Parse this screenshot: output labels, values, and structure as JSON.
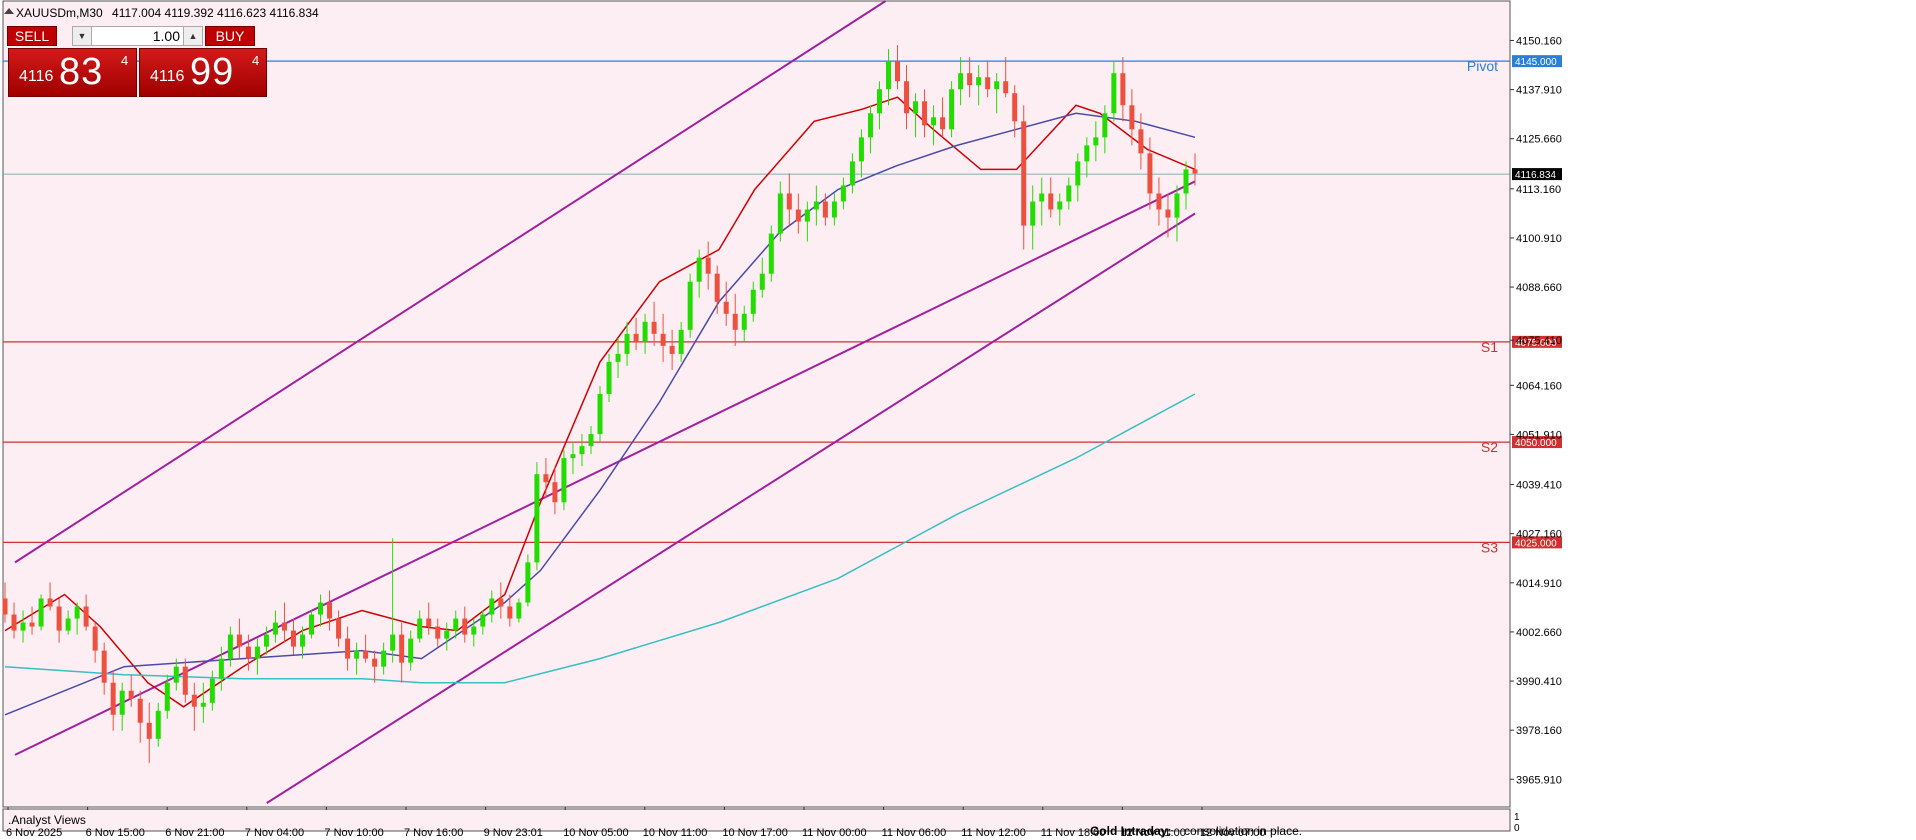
{
  "header": {
    "symbol_label": "XAUUSDm,M30",
    "ohlc": "4117.004 4119.392 4116.623 4116.834"
  },
  "trade_panel": {
    "sell_label": "SELL",
    "buy_label": "BUY",
    "lot_value": "1.00",
    "sell_price_small": "4116",
    "sell_price_big": "83",
    "sell_price_sup": "4",
    "buy_price_small": "4116",
    "buy_price_big": "99",
    "buy_price_sup": "4",
    "down_arrow": "▼",
    "up_arrow": "▲"
  },
  "indicator_panel": {
    "label": ".Analyst Views",
    "text_title": "Gold Intraday:",
    "text_body": "consolidation in place.",
    "scale_top": "1",
    "scale_bottom": "0"
  },
  "colors": {
    "background": "#fdeef4",
    "bull": "#22dd00",
    "bear": "#ee5040",
    "ma_red": "#d00000",
    "ma_blue": "#4a4aa8",
    "ma_cyan": "#36c0c0",
    "channel": "#a020a0",
    "pivot": "#2a7fd8",
    "support": "#d03030"
  },
  "chart_data": {
    "type": "candlestick",
    "symbol": "XAUUSDm",
    "timeframe": "M30",
    "ylim": [
      3959,
      4160
    ],
    "y_ticks": [
      "4150.160",
      "4137.910",
      "4125.660",
      "4113.160",
      "4100.910",
      "4088.660",
      "4075.410",
      "4064.160",
      "4051.910",
      "4039.410",
      "4027.160",
      "4014.910",
      "4002.660",
      "3990.410",
      "3978.160",
      "3965.910"
    ],
    "x_ticks": [
      "6 Nov 2025",
      "6 Nov 15:00",
      "6 Nov 21:00",
      "7 Nov 04:00",
      "7 Nov 10:00",
      "7 Nov 16:00",
      "9 Nov 23:01",
      "10 Nov 05:00",
      "10 Nov 11:00",
      "10 Nov 17:00",
      "11 Nov 00:00",
      "11 Nov 06:00",
      "11 Nov 12:00",
      "11 Nov 18:00",
      "12 Nov 01:00",
      "12 Nov 07:00"
    ],
    "current_price": "4116.834",
    "levels": [
      {
        "name": "Pivot",
        "value": 4145,
        "label": "4145.000"
      },
      {
        "name": "S1",
        "value": 4075,
        "label": "4075.000"
      },
      {
        "name": "S2",
        "value": 4050,
        "label": "4050.000"
      },
      {
        "name": "S3",
        "value": 4025,
        "label": "4025.000"
      }
    ],
    "channels": [
      {
        "x": [
          0,
          0.74
        ],
        "y": [
          4020,
          4160
        ]
      },
      {
        "x": [
          0,
          1
        ],
        "y": [
          3972,
          4115
        ]
      },
      {
        "x": [
          0.22,
          1
        ],
        "y": [
          3960,
          4107
        ]
      }
    ],
    "moving_averages": [
      {
        "color": "ma_red",
        "x": [
          0,
          0.05,
          0.08,
          0.12,
          0.15,
          0.2,
          0.25,
          0.3,
          0.35,
          0.38,
          0.42,
          0.45,
          0.5,
          0.55,
          0.6,
          0.63,
          0.68,
          0.72,
          0.75,
          0.78,
          0.82,
          0.85,
          0.9,
          0.92,
          0.96,
          1
        ],
        "y": [
          4003,
          4012,
          4004,
          3990,
          3984,
          3994,
          4003,
          4008,
          4004,
          4003,
          4012,
          4035,
          4070,
          4090,
          4098,
          4113,
          4130,
          4133,
          4136,
          4128,
          4118,
          4118,
          4134,
          4132,
          4123,
          4118
        ]
      },
      {
        "color": "ma_blue",
        "x": [
          0,
          0.1,
          0.2,
          0.3,
          0.35,
          0.38,
          0.42,
          0.45,
          0.5,
          0.55,
          0.6,
          0.65,
          0.7,
          0.75,
          0.8,
          0.85,
          0.9,
          0.95,
          1
        ],
        "y": [
          3982,
          3994,
          3996,
          3998,
          3996,
          4002,
          4010,
          4018,
          4038,
          4060,
          4085,
          4102,
          4113,
          4119,
          4124,
          4128,
          4132,
          4130,
          4126
        ]
      },
      {
        "color": "ma_cyan",
        "x": [
          0,
          0.1,
          0.2,
          0.3,
          0.35,
          0.42,
          0.5,
          0.6,
          0.7,
          0.8,
          0.9,
          1
        ],
        "y": [
          3994,
          3992,
          3991,
          3991,
          3990,
          3990,
          3996,
          4005,
          4016,
          4032,
          4046,
          4062
        ]
      }
    ],
    "candles": [
      [
        4011,
        4015,
        4005,
        4007
      ],
      [
        4007,
        4010,
        4001,
        4003
      ],
      [
        4003,
        4008,
        4000,
        4005
      ],
      [
        4005,
        4009,
        4002,
        4004
      ],
      [
        4004,
        4012,
        4003,
        4011
      ],
      [
        4011,
        4015,
        4008,
        4009
      ],
      [
        4009,
        4011,
        4000,
        4003
      ],
      [
        4003,
        4008,
        4002,
        4006
      ],
      [
        4006,
        4010,
        4002,
        4009
      ],
      [
        4009,
        4012,
        4003,
        4004
      ],
      [
        4004,
        4005,
        3995,
        3998
      ],
      [
        3998,
        4000,
        3987,
        3990
      ],
      [
        3990,
        3993,
        3978,
        3982
      ],
      [
        3982,
        3990,
        3978,
        3988
      ],
      [
        3988,
        3992,
        3984,
        3986
      ],
      [
        3986,
        3988,
        3975,
        3980
      ],
      [
        3980,
        3985,
        3970,
        3976
      ],
      [
        3976,
        3985,
        3974,
        3983
      ],
      [
        3983,
        3992,
        3981,
        3990
      ],
      [
        3990,
        3996,
        3988,
        3994
      ],
      [
        3994,
        3996,
        3985,
        3987
      ],
      [
        3987,
        3990,
        3978,
        3984
      ],
      [
        3984,
        3990,
        3980,
        3985
      ],
      [
        3985,
        3993,
        3983,
        3991
      ],
      [
        3991,
        3999,
        3988,
        3996
      ],
      [
        3996,
        4004,
        3994,
        4002
      ],
      [
        4002,
        4006,
        3996,
        3999
      ],
      [
        3999,
        4002,
        3993,
        3996
      ],
      [
        3996,
        4001,
        3992,
        3999
      ],
      [
        3999,
        4004,
        3997,
        4002
      ],
      [
        4002,
        4008,
        4000,
        4005
      ],
      [
        4005,
        4010,
        4000,
        4003
      ],
      [
        4003,
        4006,
        3997,
        3999
      ],
      [
        3999,
        4004,
        3996,
        4002
      ],
      [
        4002,
        4008,
        4001,
        4007
      ],
      [
        4007,
        4012,
        4004,
        4010
      ],
      [
        4010,
        4013,
        4003,
        4006
      ],
      [
        4006,
        4008,
        3999,
        4001
      ],
      [
        4001,
        4004,
        3993,
        3996
      ],
      [
        3996,
        4000,
        3992,
        3998
      ],
      [
        3998,
        4002,
        3995,
        3996
      ],
      [
        3996,
        3998,
        3990,
        3994
      ],
      [
        3994,
        4000,
        3992,
        3998
      ],
      [
        3998,
        4026,
        3995,
        4002
      ],
      [
        4002,
        4005,
        3990,
        3995
      ],
      [
        3995,
        4003,
        3993,
        4001
      ],
      [
        4001,
        4008,
        4000,
        4006
      ],
      [
        4006,
        4010,
        4002,
        4004
      ],
      [
        4004,
        4006,
        3999,
        4001
      ],
      [
        4001,
        4005,
        3998,
        4003
      ],
      [
        4003,
        4008,
        4001,
        4006
      ],
      [
        4006,
        4009,
        4000,
        4002
      ],
      [
        4002,
        4006,
        3999,
        4004
      ],
      [
        4004,
        4008,
        4002,
        4007
      ],
      [
        4007,
        4013,
        4005,
        4011
      ],
      [
        4011,
        4015,
        4006,
        4009
      ],
      [
        4009,
        4012,
        4004,
        4006
      ],
      [
        4006,
        4011,
        4005,
        4010
      ],
      [
        4010,
        4022,
        4009,
        4020
      ],
      [
        4020,
        4045,
        4018,
        4042
      ],
      [
        4042,
        4046,
        4036,
        4040
      ],
      [
        4040,
        4044,
        4032,
        4035
      ],
      [
        4035,
        4048,
        4033,
        4046
      ],
      [
        4046,
        4050,
        4042,
        4047
      ],
      [
        4047,
        4052,
        4044,
        4049
      ],
      [
        4049,
        4054,
        4047,
        4052
      ],
      [
        4052,
        4064,
        4050,
        4062
      ],
      [
        4062,
        4072,
        4060,
        4070
      ],
      [
        4070,
        4076,
        4066,
        4072
      ],
      [
        4072,
        4080,
        4069,
        4077
      ],
      [
        4077,
        4081,
        4073,
        4075
      ],
      [
        4075,
        4082,
        4072,
        4080
      ],
      [
        4080,
        4085,
        4074,
        4077
      ],
      [
        4077,
        4082,
        4070,
        4074
      ],
      [
        4074,
        4078,
        4068,
        4072
      ],
      [
        4072,
        4080,
        4070,
        4078
      ],
      [
        4078,
        4092,
        4076,
        4090
      ],
      [
        4090,
        4098,
        4086,
        4096
      ],
      [
        4096,
        4100,
        4088,
        4092
      ],
      [
        4092,
        4094,
        4082,
        4085
      ],
      [
        4085,
        4090,
        4079,
        4082
      ],
      [
        4082,
        4087,
        4074,
        4078
      ],
      [
        4078,
        4084,
        4075,
        4082
      ],
      [
        4082,
        4090,
        4080,
        4088
      ],
      [
        4088,
        4096,
        4086,
        4092
      ],
      [
        4092,
        4104,
        4090,
        4102
      ],
      [
        4102,
        4115,
        4100,
        4112
      ],
      [
        4112,
        4117,
        4104,
        4108
      ],
      [
        4108,
        4112,
        4102,
        4105
      ],
      [
        4105,
        4110,
        4100,
        4108
      ],
      [
        4108,
        4114,
        4104,
        4110
      ],
      [
        4110,
        4112,
        4104,
        4106
      ],
      [
        4106,
        4112,
        4104,
        4110
      ],
      [
        4110,
        4116,
        4108,
        4114
      ],
      [
        4114,
        4122,
        4112,
        4120
      ],
      [
        4120,
        4128,
        4116,
        4126
      ],
      [
        4126,
        4134,
        4122,
        4132
      ],
      [
        4132,
        4140,
        4128,
        4138
      ],
      [
        4138,
        4148,
        4134,
        4145
      ],
      [
        4145,
        4149,
        4138,
        4140
      ],
      [
        4140,
        4144,
        4128,
        4132
      ],
      [
        4132,
        4137,
        4126,
        4135
      ],
      [
        4135,
        4138,
        4126,
        4129
      ],
      [
        4129,
        4134,
        4124,
        4131
      ],
      [
        4131,
        4136,
        4126,
        4128
      ],
      [
        4128,
        4140,
        4126,
        4138
      ],
      [
        4138,
        4146,
        4134,
        4142
      ],
      [
        4142,
        4146,
        4136,
        4139
      ],
      [
        4139,
        4144,
        4134,
        4141
      ],
      [
        4141,
        4145,
        4136,
        4138
      ],
      [
        4138,
        4142,
        4132,
        4140
      ],
      [
        4140,
        4146,
        4136,
        4137
      ],
      [
        4137,
        4139,
        4126,
        4130
      ],
      [
        4130,
        4134,
        4098,
        4104
      ],
      [
        4104,
        4114,
        4098,
        4110
      ],
      [
        4110,
        4116,
        4104,
        4112
      ],
      [
        4112,
        4116,
        4106,
        4108
      ],
      [
        4108,
        4112,
        4104,
        4110
      ],
      [
        4110,
        4116,
        4108,
        4114
      ],
      [
        4114,
        4122,
        4110,
        4120
      ],
      [
        4120,
        4126,
        4116,
        4124
      ],
      [
        4124,
        4130,
        4120,
        4126
      ],
      [
        4126,
        4134,
        4122,
        4132
      ],
      [
        4132,
        4145,
        4130,
        4142
      ],
      [
        4142,
        4146,
        4130,
        4134
      ],
      [
        4134,
        4138,
        4124,
        4128
      ],
      [
        4128,
        4132,
        4118,
        4122
      ],
      [
        4122,
        4126,
        4108,
        4112
      ],
      [
        4112,
        4116,
        4104,
        4108
      ],
      [
        4108,
        4112,
        4101,
        4106
      ],
      [
        4106,
        4114,
        4100,
        4112
      ],
      [
        4112,
        4120,
        4108,
        4118
      ],
      [
        4118,
        4122,
        4114,
        4117
      ]
    ]
  }
}
